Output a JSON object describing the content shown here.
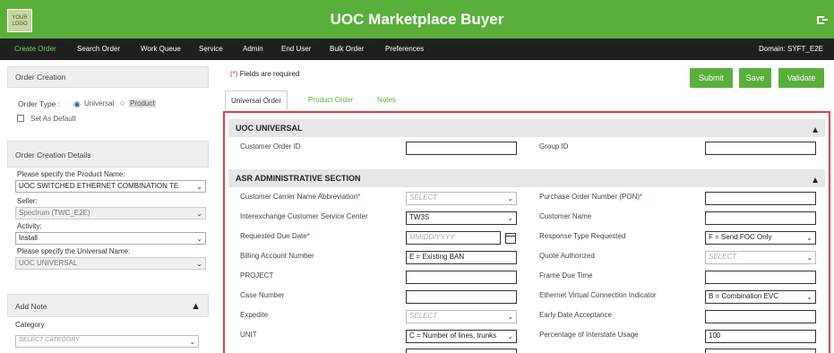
{
  "app": {
    "logo_text": "YOUR LOGO",
    "title": "UOC Marketplace Buyer"
  },
  "nav": {
    "items": [
      "Create Order",
      "Search Order",
      "Work Queue",
      "Service",
      "Admin",
      "End User",
      "Bulk Order",
      "Preferences"
    ],
    "domain": "Domain: SYFT_E2E"
  },
  "left": {
    "order_creation": {
      "header": "Order Creation",
      "order_type_label": "Order Type :",
      "opt_universal": "Universal",
      "opt_product": "Product",
      "set_default": "Set As Default"
    },
    "details": {
      "header": "Order Creation Details",
      "product_label": "Please specify the Product Name:",
      "product_value": "UOC SWITCHED ETHERNET COMBINATION TE",
      "seller_label": "Seller:",
      "seller_value": "Spectrum (TWC_E2E)",
      "activity_label": "Activity:",
      "activity_value": "Install",
      "universal_label": "Please specify the Universal Name:",
      "universal_value": "UOC UNIVERSAL"
    },
    "note": {
      "header": "Add Note",
      "category_label": "Category",
      "category_placeholder": "SELECT CATEGORY"
    }
  },
  "main": {
    "required_text": "Fields are required",
    "buttons": {
      "submit": "Submit",
      "save": "Save",
      "validate": "Validate"
    },
    "tabs": [
      "Universal Order",
      "Product Order",
      "Notes"
    ],
    "uoc_universal": {
      "title": "UOC UNIVERSAL",
      "customer_order_id": "Customer Order ID",
      "group_id": "Group ID"
    },
    "asr": {
      "title": "ASR ADMINISTRATIVE SECTION",
      "ccna_label": "Customer Carrier Name Abbreviation",
      "ccna_value": "SELECT",
      "pon_label": "Purchase Order Number (PON)",
      "icsc_label": "Interexchange Customer Service Center",
      "icsc_value": "TW3S",
      "customer_name_label": "Customer Name",
      "ddd_label": "Requested Due Date",
      "ddd_placeholder": "MM/DD/YYYY",
      "response_label": "Response Type Requested",
      "response_value": "F = Send FOC Only",
      "ban_label": "Billing Account Number",
      "ban_value": "E = Existing BAN",
      "quote_label": "Quote Authorized",
      "quote_value": "SELECT",
      "project_label": "PROJECT",
      "frame_label": "Frame Due Time",
      "case_label": "Case Number",
      "evc_label": "Ethernet Virtual Connection Indicator",
      "evc_value": "B = Combination EVC",
      "expedite_label": "Expedite",
      "expedite_value": "SELECT",
      "early_label": "Early Date Acceptance",
      "unit_label": "UNIT",
      "unit_value": "C = Number of lines, trunks",
      "pct_label": "Percentage of Interstate Usage",
      "pct_value": "100"
    }
  }
}
